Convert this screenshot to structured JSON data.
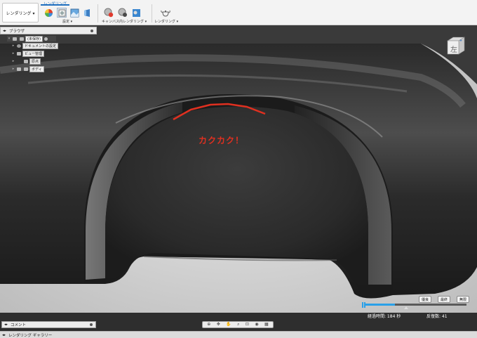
{
  "toolbar": {
    "workspace_label": "レンダリング ▾",
    "tab_label": "レンダリング",
    "setup_label": "設定 ▾",
    "in_canvas_label": "キャンバス内レンダリング ▾",
    "render_label": "レンダリング ▾",
    "icons": [
      "appearance-icon",
      "scene-settings-icon",
      "texture-map-icon",
      "decal-icon",
      "in-canvas-render-icon",
      "in-canvas-stop-icon",
      "capture-image-icon",
      "render-teapot-icon"
    ]
  },
  "browser": {
    "title": "ブラウザ",
    "items": [
      {
        "label": "(未保存)"
      },
      {
        "label": "ドキュメントの設定"
      },
      {
        "label": "ビュー管理"
      },
      {
        "label": "原点"
      },
      {
        "label": "ボディ"
      }
    ]
  },
  "viewcube": {
    "face_label": "左"
  },
  "annotation": {
    "text": "カクカク！",
    "color": "#e03020"
  },
  "render_controls": {
    "buttons": [
      "優良",
      "最終",
      "無限"
    ],
    "elapsed": "経過時間: 184 秒",
    "iterations": "反復数: 41",
    "progress": 0.3
  },
  "comments": {
    "title": "コメント"
  },
  "navbar": {
    "icons": [
      "orbit-icon",
      "pan-icon",
      "hand-icon",
      "zoom-icon",
      "zoom-window-icon",
      "display-settings-icon",
      "grid-settings-icon"
    ]
  },
  "gallery": {
    "title": "レンダリング ギャラリー"
  }
}
